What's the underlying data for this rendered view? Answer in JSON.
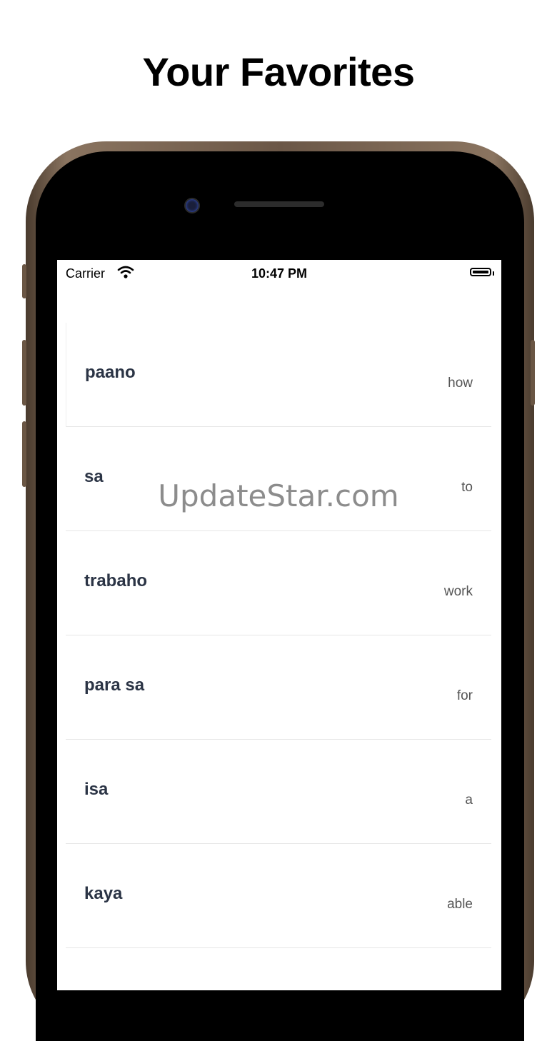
{
  "headline": "Your Favorites",
  "status_bar": {
    "carrier": "Carrier",
    "time": "10:47 PM"
  },
  "favorites": [
    {
      "word": "paano",
      "translation": "how"
    },
    {
      "word": "sa",
      "translation": "to"
    },
    {
      "word": "trabaho",
      "translation": "work"
    },
    {
      "word": "para sa",
      "translation": "for"
    },
    {
      "word": "isa",
      "translation": "a"
    },
    {
      "word": "kaya",
      "translation": "able"
    }
  ],
  "watermark": "UpdateStar.com",
  "icons": [
    "wifi-icon",
    "battery-icon"
  ],
  "colors": {
    "word_text": "#2b3445",
    "translation_text": "#555555",
    "frame": "#6b5747"
  }
}
